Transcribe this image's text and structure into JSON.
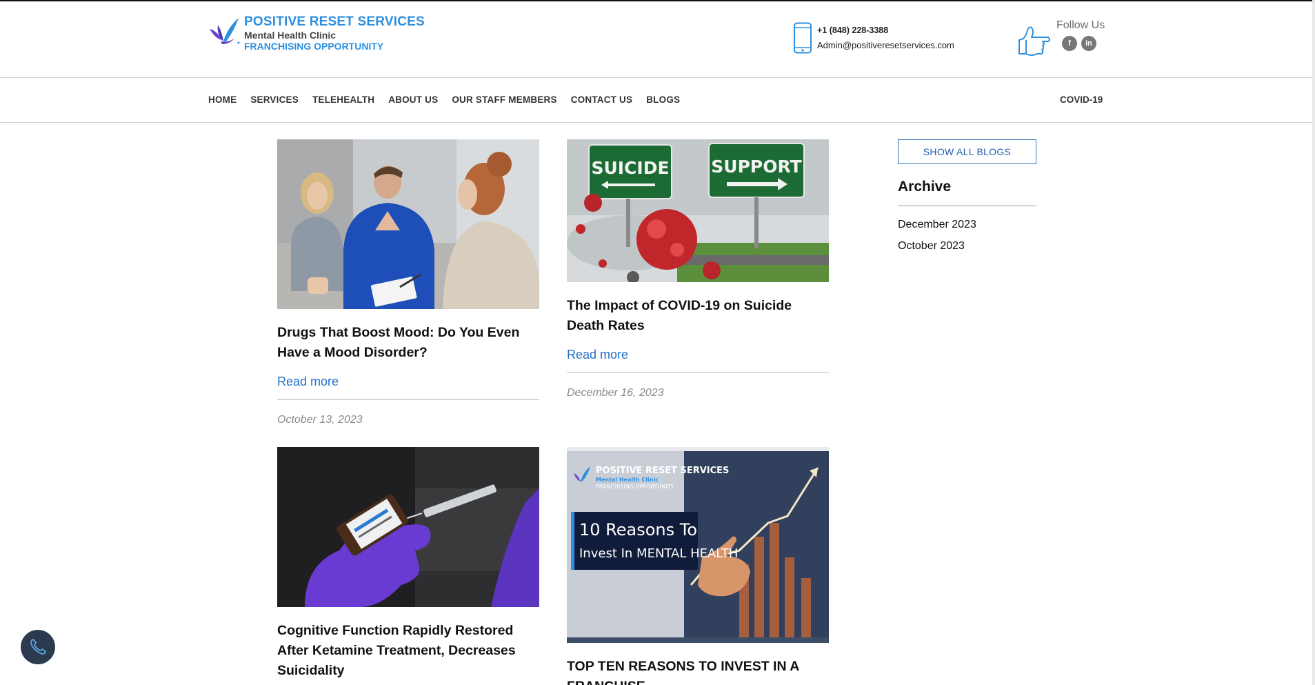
{
  "header": {
    "logo_title": "POSITIVE RESET SERVICES",
    "logo_subtitle": "Mental Health Clinic",
    "logo_tagline": "FRANCHISING OPPORTUNITY",
    "phone": "+1 (848) 228-3388",
    "email": "Admin@positiveresetservices.com",
    "follow_label": "Follow Us",
    "social": [
      {
        "icon": "facebook-icon",
        "glyph": "f"
      },
      {
        "icon": "linkedin-icon",
        "glyph": "in"
      }
    ]
  },
  "nav": {
    "items": [
      "HOME",
      "SERVICES",
      "TELEHEALTH",
      "ABOUT US",
      "OUR STAFF MEMBERS",
      "CONTACT US",
      "BLOGS"
    ],
    "right_item": "COVID-19"
  },
  "posts": [
    {
      "title": "Drugs That Boost Mood: Do You Even Have a Mood Disorder?",
      "read_more": "Read more",
      "date": "October 13, 2023"
    },
    {
      "title": "The Impact of COVID-19 on Suicide Death Rates",
      "read_more": "Read more",
      "date": "December 16, 2023",
      "image_sign_left": "SUICIDE",
      "image_sign_right": "SUPPORT"
    },
    {
      "title": "Cognitive Function Rapidly Restored After Ketamine Treatment, Decreases Suicidality"
    },
    {
      "title": "TOP TEN REASONS TO INVEST IN A FRANCHISE",
      "image_brand": "POSITIVE RESET SERVICES",
      "image_brand_sub": "Mental Health Clinic",
      "image_brand_tag": "FRANCHISING OPPORTUNITY",
      "image_heading_line1": "10 Reasons To",
      "image_heading_line2": "Invest In MENTAL HEALTH"
    }
  ],
  "sidebar": {
    "show_all": "SHOW ALL BLOGS",
    "archive_title": "Archive",
    "archive_links": [
      "December 2023",
      "October 2023"
    ]
  },
  "colors": {
    "brand_blue": "#2d8fe0",
    "link_blue": "#1f6fc4",
    "call_button": "#2b3a4e"
  }
}
